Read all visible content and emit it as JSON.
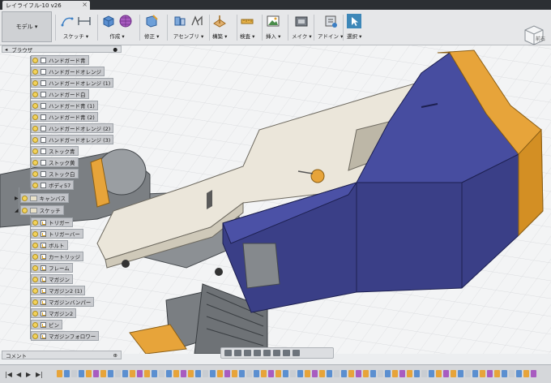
{
  "document": {
    "title": "レイライフル-10 v26",
    "close": "×"
  },
  "toolbar": {
    "workspace": "モデル ▾",
    "groups": [
      {
        "label": "スケッチ ▾",
        "icons": [
          "sketch-arc-icon",
          "sketch-line-icon"
        ]
      },
      {
        "label": "作成 ▾",
        "icons": [
          "box-icon",
          "form-icon"
        ]
      },
      {
        "label": "修正 ▾",
        "icons": [
          "modify-icon"
        ]
      },
      {
        "label": "アセンブリ ▾",
        "icons": [
          "joint-icon",
          "joint2-icon"
        ]
      },
      {
        "label": "構築 ▾",
        "icons": [
          "construct-icon"
        ]
      },
      {
        "label": "検査 ▾",
        "icons": [
          "inspect-icon"
        ]
      },
      {
        "label": "挿入 ▾",
        "icons": [
          "insert-icon"
        ]
      },
      {
        "label": "メイク ▾",
        "icons": [
          "make-icon"
        ]
      },
      {
        "label": "アドイン ▾",
        "icons": [
          "addin-icon"
        ]
      },
      {
        "label": "選択 ▾",
        "icons": [
          "select-icon"
        ]
      }
    ]
  },
  "viewcube": {
    "label": "前右"
  },
  "browser": {
    "title": "ブラウザ",
    "bodies": [
      "ハンドガード青",
      "ハンドガードオレンジ",
      "ハンドガードオレンジ (1)",
      "ハンドガード白",
      "ハンドガード青 (1)",
      "ハンドガード青 (2)",
      "ハンドガードオレンジ (2)",
      "ハンドガードオレンジ (3)",
      "ストック青",
      "ストック黄",
      "ストック白",
      "ボディ57"
    ],
    "folders": [
      "キャンバス",
      "スケッチ"
    ],
    "sketches": [
      "トリガー",
      "トリガーバー",
      "ボルト",
      "カートリッジ",
      "フレーム",
      "マガジン",
      "マガジン2 (1)",
      "マガジンバンパー",
      "マガジン2",
      "ピン",
      "マガジンフォロワー"
    ]
  },
  "comment": {
    "label": "コメント"
  },
  "colors": {
    "blue": "#3a3f87",
    "orange": "#e7a43a",
    "cream": "#e9e4d7",
    "dark": "#6b6f73"
  }
}
